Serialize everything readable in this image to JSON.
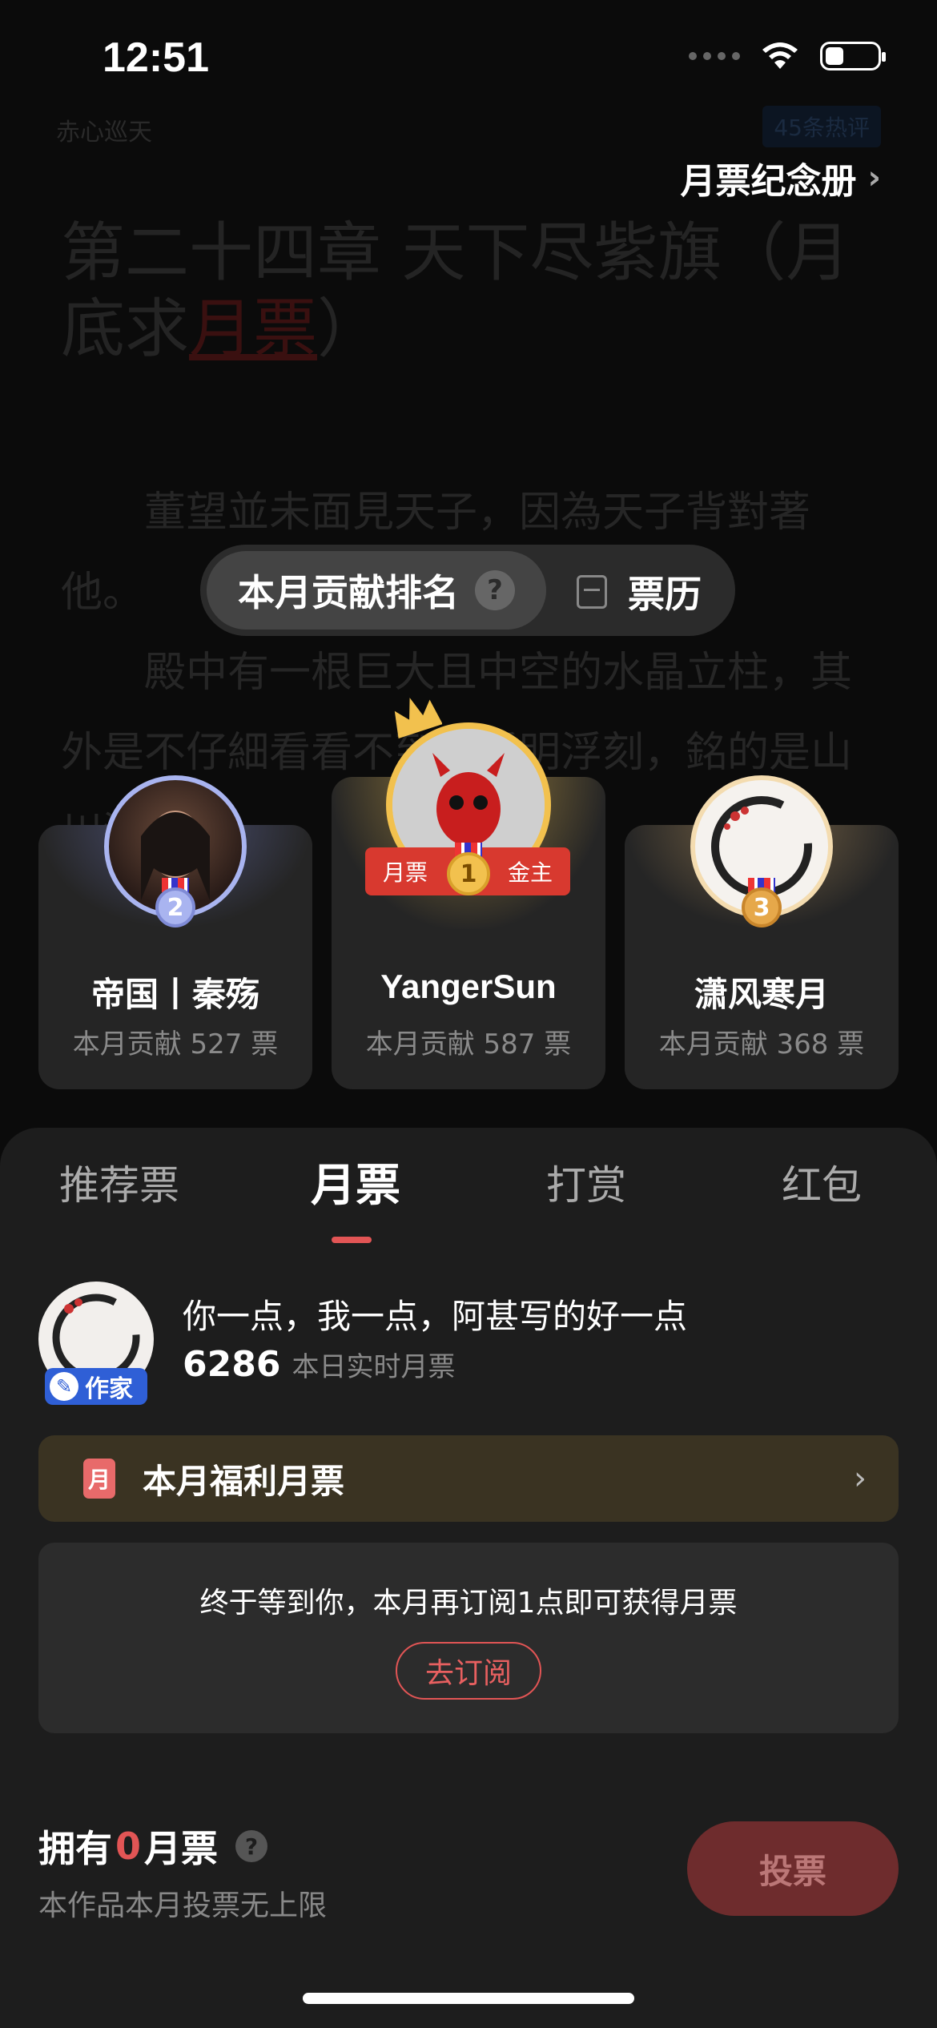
{
  "status_bar": {
    "time": "12:51"
  },
  "reader_background": {
    "book_meta": "赤心巡天",
    "comments_badge": "45条热评",
    "chapter_title_prefix": "第二十四章 天下尽紫旗（月底求",
    "chapter_title_highlight": "月票",
    "chapter_title_suffix": "）",
    "para1": "　　董望並未面見天子，因為天子背對著他。",
    "para2": "　　殿中有一根巨大且中空的水晶立柱，其外是不仔細看看不到的透明浮刻，銘的是山川河流……"
  },
  "header": {
    "album_link": "月票纪念册",
    "album_chevron": "›"
  },
  "segment": {
    "active_label": "本月贡献排名",
    "help_icon_text": "?",
    "other_label": "票历"
  },
  "ranking": [
    {
      "rank": "2",
      "name": "帝国丨秦殇",
      "contribution": "本月贡献 527 票"
    },
    {
      "rank": "1",
      "name": "YangerSun",
      "contribution": "本月贡献 587 票",
      "ribbon_left": "月票",
      "ribbon_right": "金主"
    },
    {
      "rank": "3",
      "name": "潇风寒月",
      "contribution": "本月贡献 368 票"
    }
  ],
  "tabs": [
    "推荐票",
    "月票",
    "打赏",
    "红包"
  ],
  "active_tab": "月票",
  "author": {
    "tag": "作家",
    "quote": "你一点，我一点，阿甚写的好一点",
    "count": "6286",
    "count_label": "本日实时月票"
  },
  "welfare": {
    "icon_text": "月",
    "label": "本月福利月票",
    "chevron": "›"
  },
  "subscribe": {
    "message": "终于等到你，本月再订阅1点即可获得月票",
    "button": "去订阅"
  },
  "footer": {
    "own_prefix": "拥有",
    "own_count": "0",
    "own_suffix": "月票",
    "note": "本作品本月投票无上限",
    "vote_button": "投票"
  },
  "colors": {
    "accent": "#e25555",
    "gold": "#f2c14e",
    "silver": "#a9b4f0",
    "bronze": "#e6a84a"
  }
}
